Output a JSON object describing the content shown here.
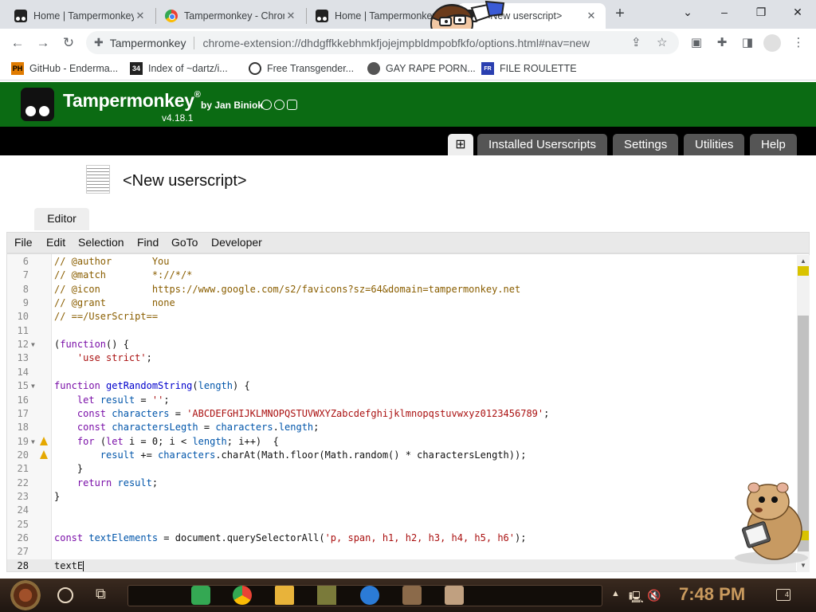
{
  "browser": {
    "tabs": [
      {
        "title": "Home | Tampermonkey",
        "favicon": "tampermonkey-icon"
      },
      {
        "title": "Tampermonkey - Chrome Web Store",
        "favicon": "chrome-web-store-icon"
      },
      {
        "title": "Home | Tampermonkey",
        "favicon": "tampermonkey-icon"
      },
      {
        "title": "<New userscript>",
        "favicon": "tampermonkey-icon"
      }
    ],
    "close_glyph": "✕",
    "new_tab": "+",
    "window_controls": {
      "minimize": "–",
      "restore": "❐",
      "close": "✕",
      "tab_search": "⌄"
    },
    "omnibox": {
      "extension_name": "Tampermonkey",
      "url": "chrome-extension://dhdgffkkebhmkfjojejmpbldmpobfkfo/options.html#nav=new"
    },
    "bookmarks": [
      {
        "label": "GitHub - Enderma...",
        "icon": "ph-icon",
        "icon_text": "PH"
      },
      {
        "label": "Index of ~dartz/i...",
        "icon": "index-icon",
        "icon_text": "34"
      },
      {
        "label": "Free Transgender...",
        "icon": "site-icon",
        "icon_text": ""
      },
      {
        "label": "GAY RAPE PORN...",
        "icon": "globe-icon",
        "icon_text": ""
      },
      {
        "label": "FILE ROULETTE",
        "icon": "file-roulette-icon",
        "icon_text": "FR"
      }
    ]
  },
  "tm": {
    "title": "Tampermonkey",
    "registered": "®",
    "by": "by Jan Biniok",
    "version": "v4.18.1",
    "nav": [
      "Installed Userscripts",
      "Settings",
      "Utilities",
      "Help"
    ],
    "plus": "⊞",
    "script_name": "<New userscript>",
    "editor_tab": "Editor",
    "menu": [
      "File",
      "Edit",
      "Selection",
      "Find",
      "GoTo",
      "Developer"
    ]
  },
  "code_lines": [
    {
      "n": "6",
      "text": "// @author       You",
      "kind": "comment"
    },
    {
      "n": "7",
      "text": "// @match        *://*/*",
      "kind": "comment"
    },
    {
      "n": "8",
      "text": "// @icon         https://www.google.com/s2/favicons?sz=64&domain=tampermonkey.net",
      "kind": "comment"
    },
    {
      "n": "9",
      "text": "// @grant        none",
      "kind": "comment"
    },
    {
      "n": "10",
      "text": "// ==/UserScript==",
      "kind": "comment"
    },
    {
      "n": "11",
      "text": "",
      "kind": "plain"
    },
    {
      "n": "12",
      "text": "(function() {",
      "kind": "fn",
      "fold": true
    },
    {
      "n": "13",
      "text": "    'use strict';",
      "kind": "string"
    },
    {
      "n": "14",
      "text": "",
      "kind": "plain"
    },
    {
      "n": "15",
      "text": "function getRandomString(length) {",
      "kind": "fndef",
      "fold": true
    },
    {
      "n": "16",
      "text": "    let result = '';",
      "kind": "let"
    },
    {
      "n": "17",
      "text": "    const characters = 'ABCDEFGHIJKLMNOPQSTUVWXYZabcdefghijklmnopqstuvwxyz0123456789';",
      "kind": "const-str"
    },
    {
      "n": "18",
      "text": "    const charactersLegth = characters.length;",
      "kind": "const"
    },
    {
      "n": "19",
      "text": "    for (let i = 0; i < length; i++)  {",
      "kind": "for",
      "fold": true,
      "warn": true
    },
    {
      "n": "20",
      "text": "        result += characters.charAt(Math.floor(Math.random() * charactersLength));",
      "kind": "plain",
      "warn": true
    },
    {
      "n": "21",
      "text": "    }",
      "kind": "plain"
    },
    {
      "n": "22",
      "text": "    return result;",
      "kind": "return"
    },
    {
      "n": "23",
      "text": "}",
      "kind": "plain"
    },
    {
      "n": "24",
      "text": "",
      "kind": "plain"
    },
    {
      "n": "25",
      "text": "",
      "kind": "plain"
    },
    {
      "n": "26",
      "text": "const textElements = document.querySelectorAll('p, span, h1, h2, h3, h4, h5, h6');",
      "kind": "const-str2"
    },
    {
      "n": "27",
      "text": "",
      "kind": "plain"
    },
    {
      "n": "28",
      "text": "textE",
      "kind": "plain",
      "current": true
    }
  ],
  "taskbar": {
    "clock": "7:48 PM",
    "notifications": "4"
  },
  "colors": {
    "tm_green": "#0b6b13",
    "nav_black": "#000000",
    "warning": "#e5a800"
  }
}
